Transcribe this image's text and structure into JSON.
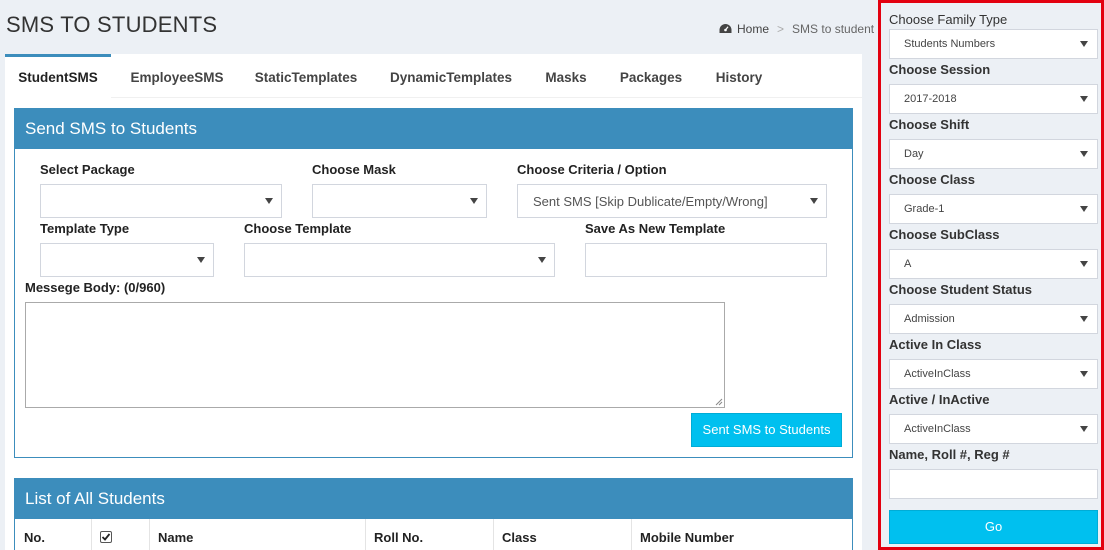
{
  "header": {
    "title": "SMS TO STUDENTS",
    "breadcrumb_home": "Home",
    "breadcrumb_sep": ">",
    "breadcrumb_current": "SMS to student"
  },
  "tabs": [
    {
      "label": "StudentSMS",
      "active": true
    },
    {
      "label": "EmployeeSMS",
      "active": false
    },
    {
      "label": "StaticTemplates",
      "active": false
    },
    {
      "label": "DynamicTemplates",
      "active": false
    },
    {
      "label": "Masks",
      "active": false
    },
    {
      "label": "Packages",
      "active": false
    },
    {
      "label": "History",
      "active": false
    }
  ],
  "send_panel": {
    "title": "Send SMS to Students",
    "select_package_label": "Select Package",
    "select_package_value": "",
    "choose_mask_label": "Choose Mask",
    "choose_mask_value": "",
    "criteria_label": "Choose Criteria / Option",
    "criteria_value": "Sent SMS [Skip Dublicate/Empty/Wrong]",
    "template_type_label": "Template Type",
    "template_type_value": "",
    "choose_template_label": "Choose Template",
    "choose_template_value": "",
    "save_template_label": "Save As New Template",
    "save_template_value": "",
    "message_body_label": "Messege Body: (0/960)",
    "message_body_value": "",
    "send_button": "Sent SMS to Students"
  },
  "list_panel": {
    "title": "List of All Students",
    "columns": [
      "No.",
      "",
      "Name",
      "Roll No.",
      "Class",
      "Mobile Number"
    ],
    "select_all_checked": true
  },
  "sidebar": {
    "family_type_label": "Choose Family Type",
    "family_type_value": "Students Numbers",
    "session_label": "Choose Session",
    "session_value": "2017-2018",
    "shift_label": "Choose Shift",
    "shift_value": "Day",
    "class_label": "Choose Class",
    "class_value": "Grade-1",
    "subclass_label": "Choose SubClass",
    "subclass_value": "A",
    "status_label": "Choose Student Status",
    "status_value": "Admission",
    "active_in_class_label": "Active In Class",
    "active_in_class_value": "ActiveInClass",
    "active_inactive_label": "Active / InActive",
    "active_inactive_value": "ActiveInClass",
    "search_label": "Name, Roll #, Reg #",
    "search_value": "",
    "go_button": "Go"
  },
  "colors": {
    "primary": "#3c8dbc",
    "info": "#00c0ef",
    "highlight_border": "#e3000f",
    "background": "#ecf0f5"
  },
  "icons": {
    "breadcrumb_home": "dashboard-icon",
    "dropdown": "caret-down-icon",
    "select_all": "checkbox-checked-icon"
  }
}
